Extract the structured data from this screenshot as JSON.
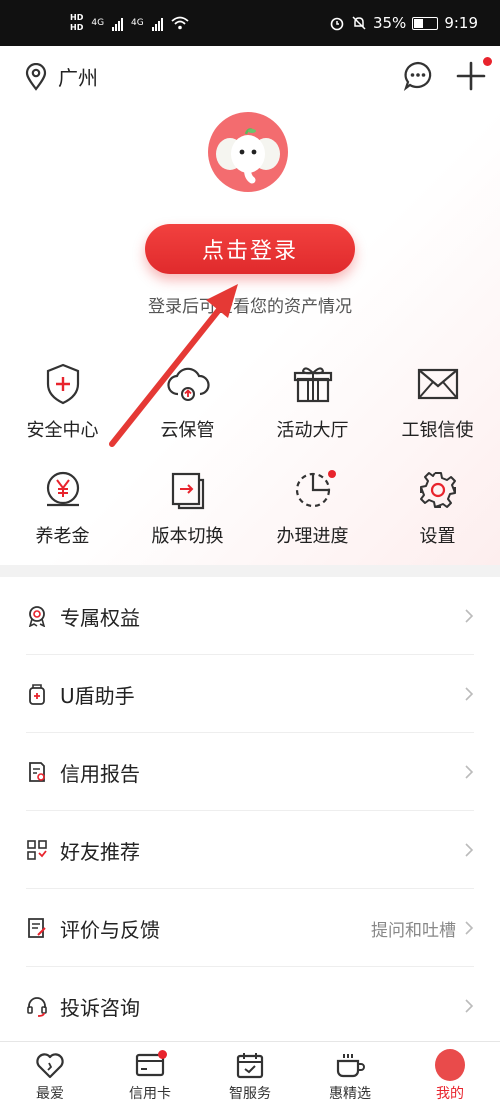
{
  "status": {
    "hd1": "HD",
    "hd2": "HD",
    "net1": "4G",
    "net2": "4G",
    "battery": "35%",
    "time": "9:19"
  },
  "header": {
    "location": "广州",
    "login_button": "点击登录",
    "login_hint": "登录后可查看您的资产情况"
  },
  "grid": [
    {
      "label": "安全中心",
      "icon": "shield-plus-icon"
    },
    {
      "label": "云保管",
      "icon": "cloud-upload-icon"
    },
    {
      "label": "活动大厅",
      "icon": "gift-icon"
    },
    {
      "label": "工银信使",
      "icon": "envelope-icon"
    },
    {
      "label": "养老金",
      "icon": "yen-coin-icon"
    },
    {
      "label": "版本切换",
      "icon": "switch-icon"
    },
    {
      "label": "办理进度",
      "icon": "progress-icon"
    },
    {
      "label": "设置",
      "icon": "gear-icon"
    }
  ],
  "list": [
    {
      "label": "专属权益",
      "extra": ""
    },
    {
      "label": "U盾助手",
      "extra": ""
    },
    {
      "label": "信用报告",
      "extra": ""
    },
    {
      "label": "好友推荐",
      "extra": ""
    },
    {
      "label": "评价与反馈",
      "extra": "提问和吐槽"
    },
    {
      "label": "投诉咨询",
      "extra": ""
    }
  ],
  "tabs": [
    {
      "label": "最爱"
    },
    {
      "label": "信用卡"
    },
    {
      "label": "智服务"
    },
    {
      "label": "惠精选"
    },
    {
      "label": "我的"
    }
  ],
  "colors": {
    "accent": "#e8242d",
    "login_button": "#e83333",
    "annotation_arrow": "#e53935"
  }
}
